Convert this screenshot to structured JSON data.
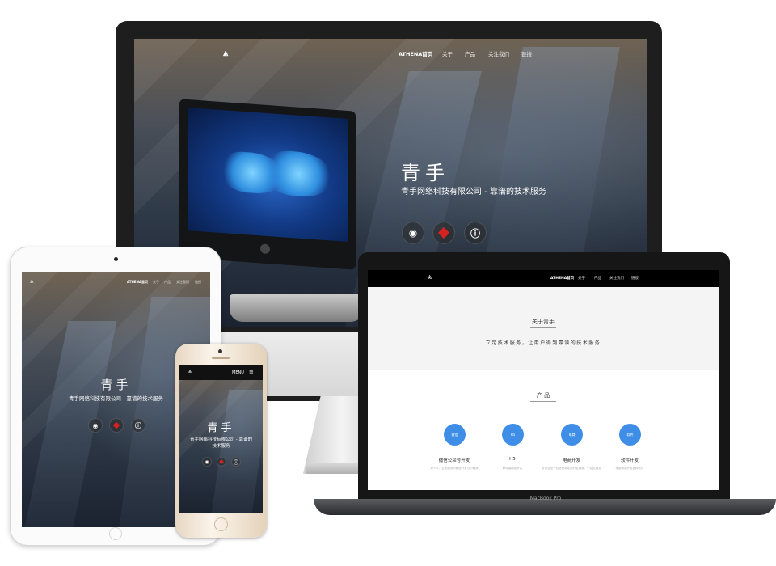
{
  "brand": {
    "mark": "⩓"
  },
  "nav": {
    "home": "ATHENA首页",
    "about": "关于",
    "products": "产品",
    "follow": "关注我们",
    "links": "链接",
    "menu": "MENU"
  },
  "hero": {
    "title": "青手",
    "subtitle": "青手网络科技有限公司 - 靠谱的技术服务",
    "subtitle_line1": "青手网络科技有限公司 - 靠谱的",
    "subtitle_line2": "技术服务",
    "buttons": [
      "github-icon",
      "red-cube-icon",
      "info-icon"
    ]
  },
  "about": {
    "title": "关于青手",
    "text": "立足技术服务，让用户得到靠谱的技术服务"
  },
  "products": {
    "title": "产 品",
    "items": [
      {
        "badge": "微信",
        "name": "微信公众号开发",
        "desc": "对个人、企业服务的微信开发与小程序",
        "color": "#3e8ee8"
      },
      {
        "badge": "H5",
        "name": "H5",
        "desc": "移动端网站开发",
        "color": "#3e8ee8"
      },
      {
        "badge": "电商",
        "name": "电商开发",
        "desc": "针对企业个性化需求定制开发商城，一站式服务",
        "color": "#3e8ee8"
      },
      {
        "badge": "软件",
        "name": "软件开发",
        "desc": "根据需求开发各种软件",
        "color": "#3e8ee8"
      }
    ]
  },
  "device": {
    "macbook_label": "MacBook Pro"
  }
}
